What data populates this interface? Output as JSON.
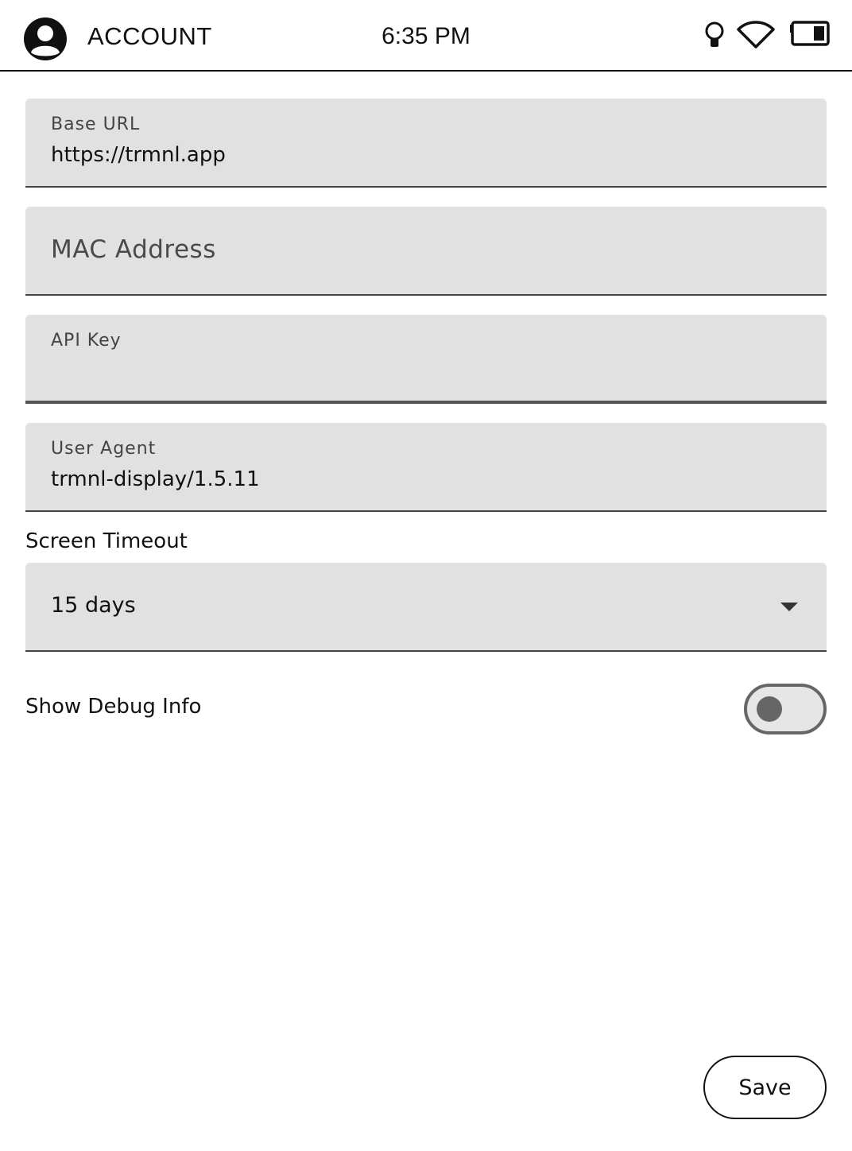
{
  "statusbar": {
    "title": "ACCOUNT",
    "time": "6:35 PM",
    "icons": [
      "account-icon",
      "frontlight-icon",
      "wifi-icon",
      "battery-icon"
    ]
  },
  "form": {
    "base_url": {
      "label": "Base URL",
      "value": "https://trmnl.app"
    },
    "mac_address": {
      "placeholder": "MAC Address",
      "value": ""
    },
    "api_key": {
      "label": "API Key",
      "value": ""
    },
    "user_agent": {
      "label": "User Agent",
      "value": "trmnl-display/1.5.11"
    },
    "screen_timeout": {
      "label": "Screen Timeout",
      "selected": "15 days"
    },
    "show_debug_info": {
      "label": "Show Debug Info",
      "enabled": false
    }
  },
  "actions": {
    "save_label": "Save"
  }
}
